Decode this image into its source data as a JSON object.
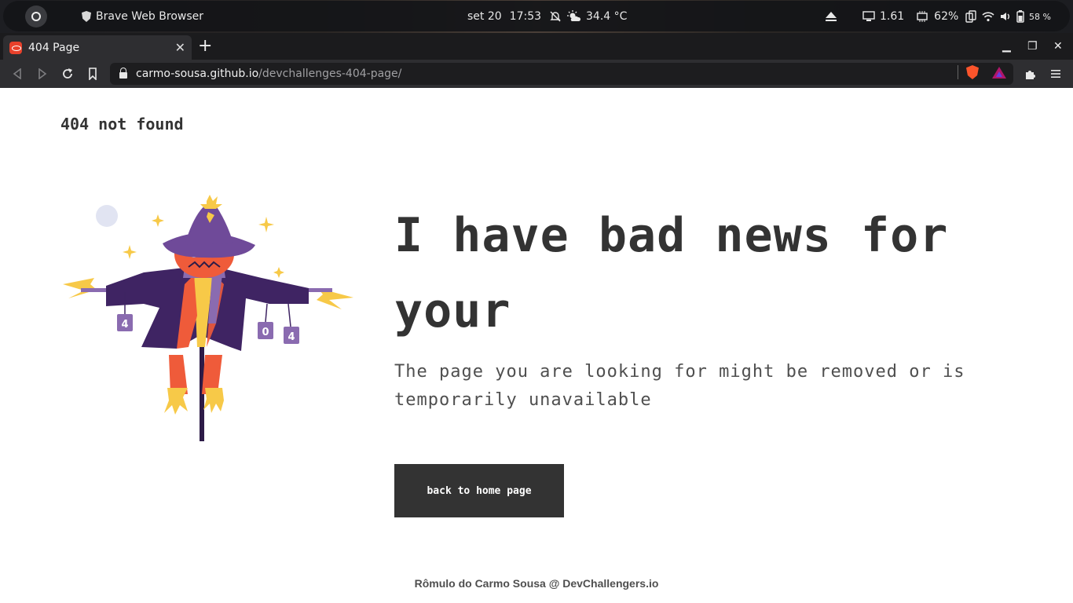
{
  "os_bar": {
    "app_name": "Brave Web Browser",
    "date": "set 20",
    "time": "17:53",
    "temperature": "34.4 °C",
    "monitor": "1.61",
    "cpu": "62%",
    "battery": "58 %"
  },
  "browser": {
    "tab_title": "404 Page",
    "url_domain": "carmo-sousa.github.io",
    "url_path": "/devchallenges-404-page/"
  },
  "page": {
    "brand": "404 not found",
    "headline": "I have bad news for your",
    "subtitle": "The page you are looking for might be removed or is temporarily unavailable",
    "button_label": "back to home page",
    "footer": "Rômulo do Carmo Sousa @ DevChallengers.io",
    "illustration_text": [
      "4",
      "0",
      "4"
    ]
  },
  "colors": {
    "text_dark": "#333333",
    "text_muted": "#4F4F4F",
    "button_bg": "#333333",
    "scarecrow_purple": "#4a2c6b",
    "scarecrow_orange": "#ef5b3a",
    "straw_yellow": "#f7c948"
  },
  "icons": [
    "activities-icon",
    "brave-shield-icon",
    "notifications-off-icon",
    "weather-icon",
    "eject-icon",
    "monitor-icon",
    "cpu-icon",
    "phone-icon",
    "wifi-icon",
    "volume-icon",
    "battery-icon",
    "back-icon",
    "forward-icon",
    "reload-icon",
    "bookmark-icon",
    "lock-icon",
    "extensions-icon",
    "menu-icon"
  ]
}
